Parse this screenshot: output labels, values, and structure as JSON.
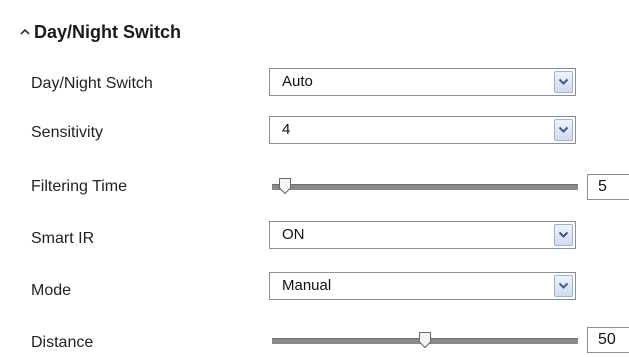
{
  "section": {
    "title": "Day/Night Switch",
    "caret_icon": "chevron-up-icon"
  },
  "fields": {
    "day_night_switch": {
      "label": "Day/Night Switch",
      "value": "Auto"
    },
    "sensitivity": {
      "label": "Sensitivity",
      "value": "4"
    },
    "filtering_time": {
      "label": "Filtering Time",
      "value": "5",
      "slider_fraction": 0.02
    },
    "smart_ir": {
      "label": "Smart IR",
      "value": "ON"
    },
    "mode": {
      "label": "Mode",
      "value": "Manual"
    },
    "distance": {
      "label": "Distance",
      "value": "50",
      "slider_fraction": 0.5
    }
  },
  "colors": {
    "dropdown_button": "#cfdcef",
    "dropdown_arrow": "#3b5a8a",
    "slider_track": "#8a8a8a",
    "border": "#8a8f96"
  }
}
